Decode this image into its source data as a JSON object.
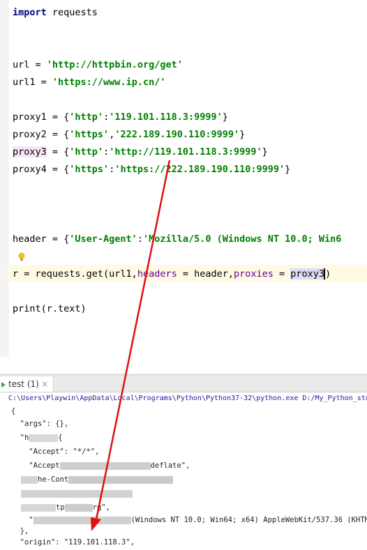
{
  "editor": {
    "lines": {
      "import_kw": "import",
      "import_rest": " requests",
      "url_lhs": "url = ",
      "url_val": "'http://httpbin.org/get'",
      "url1_lhs": "url1 = ",
      "url1_val": "'https://www.ip.cn/'",
      "proxy1_lhs": "proxy1 = {",
      "proxy1_key": "'http'",
      "proxy1_colon": ":",
      "proxy1_val": "'119.101.118.3:9999'",
      "proxy1_end": "}",
      "proxy2_lhs": "proxy2 = {",
      "proxy2_key": "'https'",
      "proxy2_colon": ",",
      "proxy2_val": "'222.189.190.110:9999'",
      "proxy2_end": "}",
      "proxy3_name": "proxy3",
      "proxy3_lhs": " = {",
      "proxy3_key": "'http'",
      "proxy3_colon": ":",
      "proxy3_val": "'http://119.101.118.3:9999'",
      "proxy3_end": "}",
      "proxy4_lhs": "proxy4 = {",
      "proxy4_key": "'https'",
      "proxy4_colon": ":",
      "proxy4_val": "'https://222.189.190.110:9999'",
      "proxy4_end": "}",
      "header_lhs": "header = {",
      "header_key": "'User-Agent'",
      "header_colon": ":",
      "header_val": "'Mozilla/5.0 (Windows NT 10.0; Win6",
      "req_lhs": "r = requests.get(url1,",
      "req_p1": "headers",
      "req_mid": " = header,",
      "req_p2": "proxies",
      "req_eq": " = ",
      "req_sel": "proxy3",
      "req_end": ")",
      "print_line": "print(r.text)"
    }
  },
  "run_panel": {
    "tab_label": "test (1)",
    "tab_close": "×",
    "console": {
      "command": "C:\\Users\\Playwin\\AppData\\Local\\Programs\\Python\\Python37-32\\python.exe D:/My_Python_stu",
      "l1": "{",
      "l2": "  \"args\": {},",
      "l3": "  \"h",
      "l3b": "{",
      "l4": "    \"Accept\": \"*/*\",",
      "l5a": "    \"Accept",
      "l5b": "deflate\",",
      "l6": "he-Cont",
      "l8a": "tp",
      "l8b": "rg\",",
      "l9a": "    \"",
      "l9b": "(Windows NT 10.0; Win64; x64) AppleWebKit/537.36 (KHTML",
      "l10": "  },",
      "l11": "  \"origin\": \"119.101.118.3\","
    }
  },
  "colors": {
    "keyword": "#000080",
    "string": "#008000",
    "param": "#660099",
    "arrow": "#e01010",
    "console_cmd": "#1d1d9e"
  },
  "icons": [
    "lightbulb-icon",
    "run-tab-icon",
    "close-icon"
  ]
}
